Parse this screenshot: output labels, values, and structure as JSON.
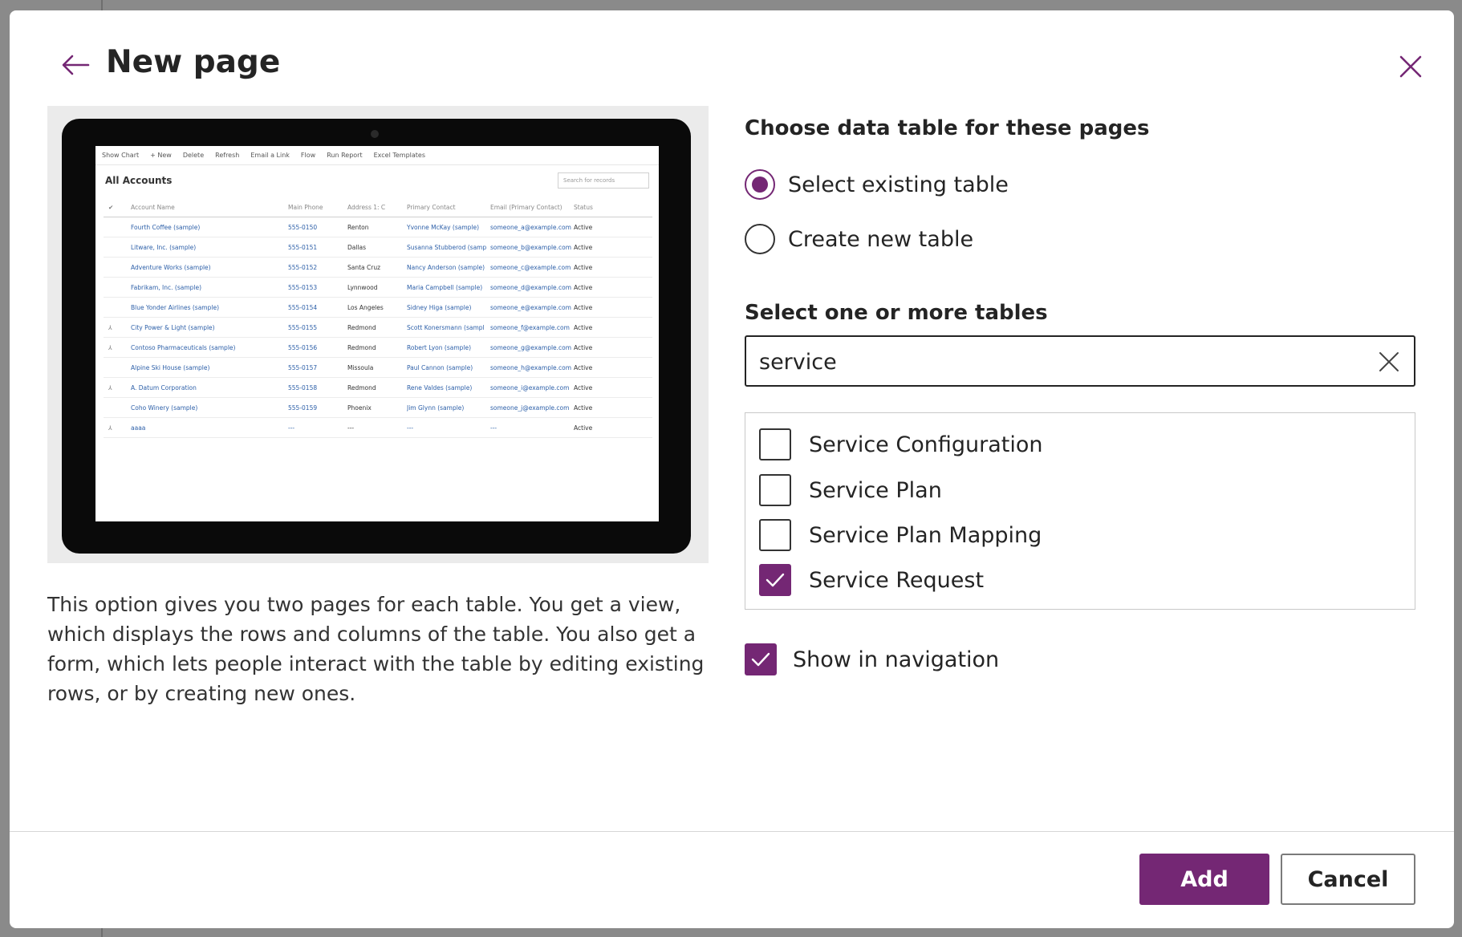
{
  "dialog": {
    "title": "New page"
  },
  "preview": {
    "commands": [
      "Show Chart",
      "+ New",
      "Delete",
      "Refresh",
      "Email a Link",
      "Flow",
      "Run Report",
      "Excel Templates"
    ],
    "view_title": "All Accounts",
    "search_placeholder": "Search for records",
    "columns": [
      "Account Name",
      "Main Phone",
      "Address 1: C",
      "Primary Contact",
      "Email (Primary Contact)",
      "Status"
    ],
    "rows": [
      [
        "",
        "Fourth Coffee (sample)",
        "555-0150",
        "Renton",
        "Yvonne McKay (sample)",
        "someone_a@example.com",
        "Active"
      ],
      [
        "",
        "Litware, Inc. (sample)",
        "555-0151",
        "Dallas",
        "Susanna Stubberod (samp",
        "someone_b@example.com",
        "Active"
      ],
      [
        "",
        "Adventure Works (sample)",
        "555-0152",
        "Santa Cruz",
        "Nancy Anderson (sample)",
        "someone_c@example.com",
        "Active"
      ],
      [
        "",
        "Fabrikam, Inc. (sample)",
        "555-0153",
        "Lynnwood",
        "Maria Campbell (sample)",
        "someone_d@example.com",
        "Active"
      ],
      [
        "",
        "Blue Yonder Airlines (sample)",
        "555-0154",
        "Los Angeles",
        "Sidney Higa (sample)",
        "someone_e@example.com",
        "Active"
      ],
      [
        "⅄",
        "City Power & Light (sample)",
        "555-0155",
        "Redmond",
        "Scott Konersmann (sampl",
        "someone_f@example.com",
        "Active"
      ],
      [
        "⅄",
        "Contoso Pharmaceuticals (sample)",
        "555-0156",
        "Redmond",
        "Robert Lyon (sample)",
        "someone_g@example.com",
        "Active"
      ],
      [
        "",
        "Alpine Ski House (sample)",
        "555-0157",
        "Missoula",
        "Paul Cannon (sample)",
        "someone_h@example.com",
        "Active"
      ],
      [
        "⅄",
        "A. Datum Corporation",
        "555-0158",
        "Redmond",
        "Rene Valdes (sample)",
        "someone_i@example.com",
        "Active"
      ],
      [
        "",
        "Coho Winery (sample)",
        "555-0159",
        "Phoenix",
        "Jim Glynn (sample)",
        "someone_j@example.com",
        "Active"
      ],
      [
        "⅄",
        "aaaa",
        "---",
        "---",
        "---",
        "---",
        "Active"
      ]
    ]
  },
  "description": "This option gives you two pages for each table. You get a view, which displays the rows and columns of the table. You also get a form, which lets people interact with the table by editing existing rows, or by creating new ones.",
  "data_table": {
    "heading": "Choose data table for these pages",
    "options": [
      {
        "label": "Select existing table",
        "checked": true
      },
      {
        "label": "Create new table",
        "checked": false
      }
    ]
  },
  "tables": {
    "heading": "Select one or more tables",
    "search_value": "service",
    "items": [
      {
        "label": "Service Configuration",
        "checked": false
      },
      {
        "label": "Service Plan",
        "checked": false
      },
      {
        "label": "Service Plan Mapping",
        "checked": false
      },
      {
        "label": "Service Request",
        "checked": true
      }
    ]
  },
  "show_in_navigation": {
    "label": "Show in navigation",
    "checked": true
  },
  "footer": {
    "add_label": "Add",
    "cancel_label": "Cancel"
  },
  "colors": {
    "accent": "#742774",
    "text": "#242424"
  }
}
